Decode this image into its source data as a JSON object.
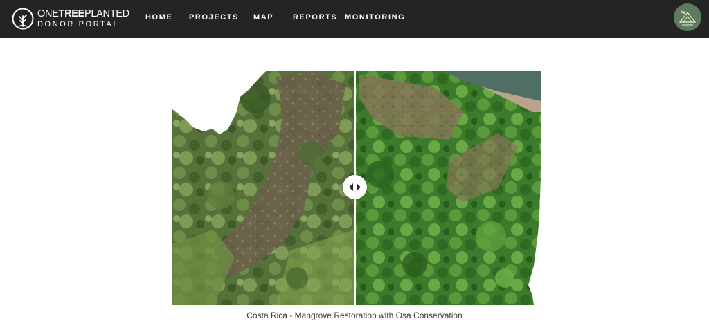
{
  "header": {
    "logo": {
      "name_part1": "ONE",
      "name_part2": "TREE",
      "name_part3": "PLANTED",
      "subtitle": "DONOR PORTAL"
    },
    "nav": [
      "HOME",
      "PROJECTS",
      "MAP",
      "REPORTS",
      "MONITORING"
    ],
    "avatar_icon": "mountain-avatar-icon"
  },
  "comparison": {
    "handle_icon": "left-right-arrows-icon",
    "handle_position": 0.5
  },
  "caption": "Costa Rica - Mangrove Restoration with Osa Conservation",
  "colors": {
    "header_bg": "#242424",
    "avatar_bg": "#5d7a5a",
    "caption_text": "#3a3a3a"
  }
}
